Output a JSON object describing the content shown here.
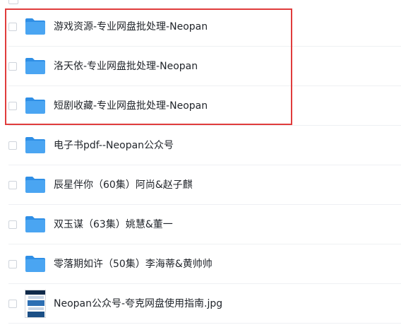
{
  "file_list": {
    "items": [
      {
        "name": "游戏资源-专业网盘批处理-Neopan",
        "type": "folder",
        "icon": "folder-icon"
      },
      {
        "name": "洛天依-专业网盘批处理-Neopan",
        "type": "folder",
        "icon": "folder-icon"
      },
      {
        "name": "短剧收藏-专业网盘批处理-Neopan",
        "type": "folder",
        "icon": "folder-icon"
      },
      {
        "name": "电子书pdf--Neopan公众号",
        "type": "folder",
        "icon": "folder-icon"
      },
      {
        "name": "辰星伴你（60集）阿尚&赵子麒",
        "type": "folder",
        "icon": "folder-icon"
      },
      {
        "name": "双玉谋（63集）姚慧&董一",
        "type": "folder",
        "icon": "folder-icon"
      },
      {
        "name": "零落期如许（50集）李海蒂&黄帅帅",
        "type": "folder",
        "icon": "folder-icon"
      },
      {
        "name": "Neopan公众号-夸克网盘使用指南.jpg",
        "type": "image",
        "icon": "image-thumbnail-icon"
      }
    ]
  },
  "colors": {
    "folder": "#4aa5f2",
    "folder_tab": "#2f8fe6",
    "highlight": "#e03c3c",
    "text": "#1f2329"
  }
}
